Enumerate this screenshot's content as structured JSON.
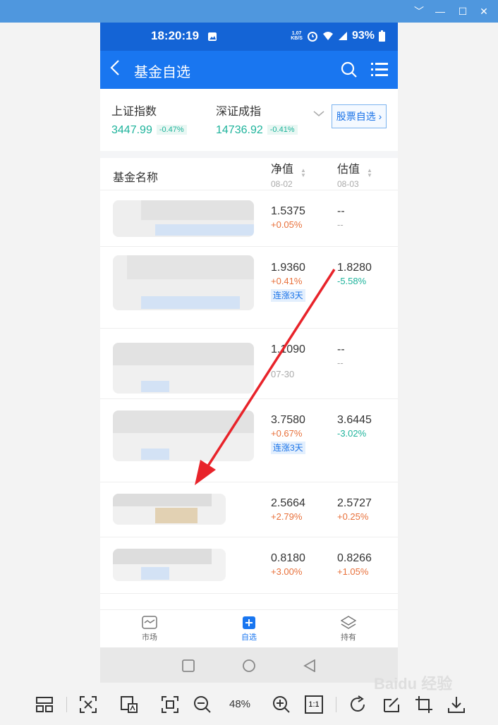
{
  "window": {
    "minimize": "﹀",
    "min_icon": "—",
    "max_icon": "☐",
    "close_icon": "✕"
  },
  "status": {
    "time": "18:20:19",
    "speed_top": "1.07",
    "speed_unit": "KB/S",
    "battery": "93%"
  },
  "nav": {
    "title": "基金自选"
  },
  "indices": [
    {
      "name": "上证指数",
      "value": "3447.99",
      "change": "-0.47%"
    },
    {
      "name": "深证成指",
      "value": "14736.92",
      "change": "-0.41%"
    }
  ],
  "stock_button": "股票自选",
  "table": {
    "col_name": "基金名称",
    "col_nav": "净值",
    "col_nav_date": "08-02",
    "col_est": "估值",
    "col_est_date": "08-03"
  },
  "rows": [
    {
      "nav": "1.5375",
      "nav_chg": "+0.05%",
      "est": "--",
      "est_chg": "--"
    },
    {
      "nav": "1.9360",
      "nav_chg": "+0.41%",
      "tag": "连涨3天",
      "est": "1.8280",
      "est_chg": "-5.58%"
    },
    {
      "nav": "1.1090",
      "nav_chg": "07-30",
      "est": "--",
      "est_chg": "--"
    },
    {
      "nav": "3.7580",
      "nav_chg": "+0.67%",
      "tag": "连涨3天",
      "est": "3.6445",
      "est_chg": "-3.02%"
    },
    {
      "nav": "2.5664",
      "nav_chg": "+2.79%",
      "est": "2.5727",
      "est_chg": "+0.25%"
    },
    {
      "nav": "0.8180",
      "nav_chg": "+3.00%",
      "est": "0.8266",
      "est_chg": "+1.05%"
    }
  ],
  "tabs": [
    {
      "label": "市场",
      "icon": "market-icon"
    },
    {
      "label": "自选",
      "icon": "watchlist-icon",
      "active": true
    },
    {
      "label": "持有",
      "icon": "holdings-icon"
    }
  ],
  "viewer": {
    "zoom": "48%",
    "ratio": "1:1",
    "watermark": "Baidu 经验"
  },
  "colors": {
    "accent": "#1976f0",
    "up": "#e8703a",
    "down": "#1db39b"
  }
}
